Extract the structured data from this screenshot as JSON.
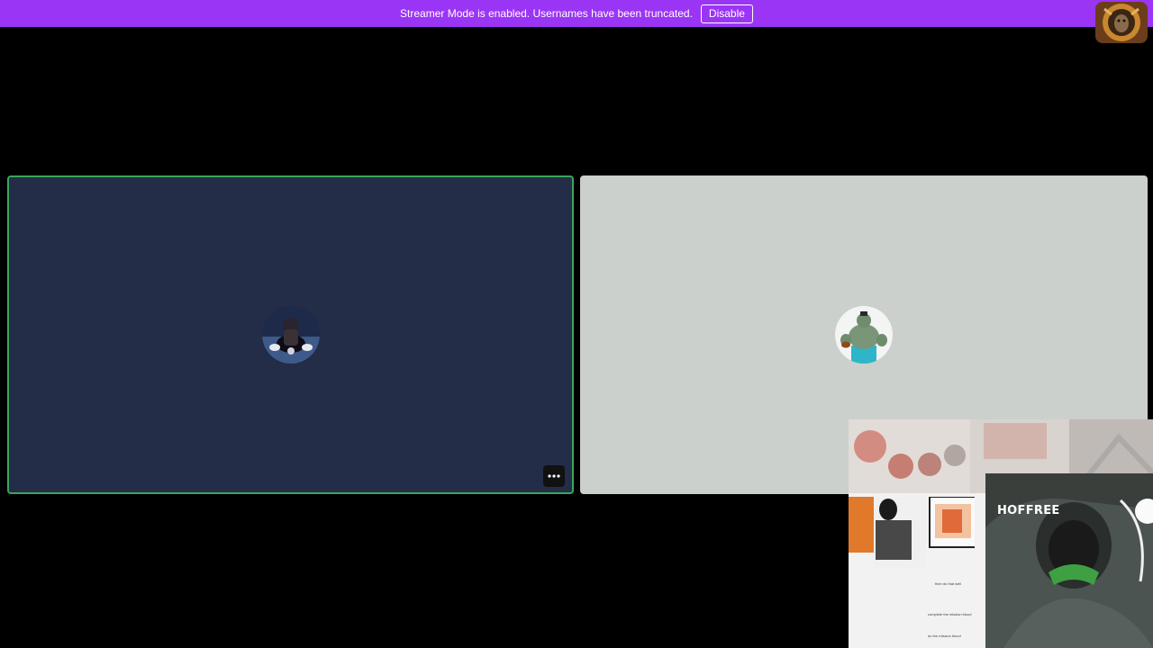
{
  "notice": {
    "message": "Streamer Mode is enabled. Usernames have been truncated.",
    "button_label": "Disable"
  },
  "tiles": {
    "left_more_button": "more-options"
  },
  "overlay": {
    "label": "HOFFREE",
    "captions": [
      "complete the mission blood",
      "do the mission blood",
      "then do that well"
    ]
  },
  "colors": {
    "banner": "#9b35f5",
    "speaking_border": "#3ba55c",
    "tile_left_bg": "#232d47",
    "tile_right_bg": "#ccd0cc"
  }
}
